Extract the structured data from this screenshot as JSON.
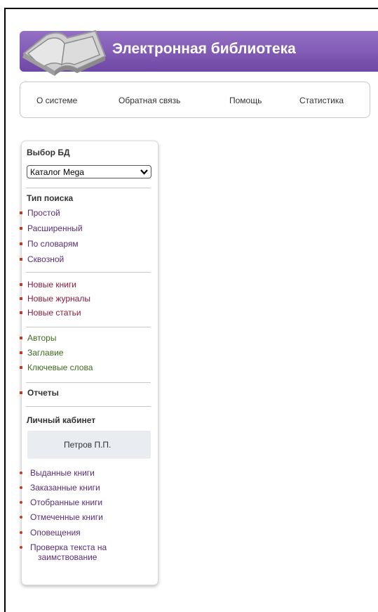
{
  "header": {
    "title": "Электронная библиотека"
  },
  "nav": {
    "items": [
      "О системе",
      "Обратная связь",
      "Помощь",
      "Статистика"
    ]
  },
  "sidebar": {
    "db_title": "Выбор БД",
    "db_select": "Каталог Mega",
    "search_type_title": "Тип поиска",
    "search_types": [
      "Простой",
      "Расширенный",
      "По словарям",
      "Сквозной"
    ],
    "new_items": [
      "Новые книги",
      "Новые журналы",
      "Новые статьи"
    ],
    "indexes": [
      "Авторы",
      "Заглавие",
      "Ключевые слова"
    ],
    "reports": "Отчеты",
    "cabinet_title": "Личный кабинет",
    "user_name": "Петров П.П.",
    "cabinet_items": [
      "Выданные книги",
      "Заказанные книги",
      "Отобранные книги",
      "Отмеченные книги",
      "Оповещения"
    ],
    "plagiarism_line1": "Проверка текста на",
    "plagiarism_line2": "заимствование"
  },
  "colors": {
    "banner": "#7a52b3",
    "bullet": "#c0392b"
  }
}
